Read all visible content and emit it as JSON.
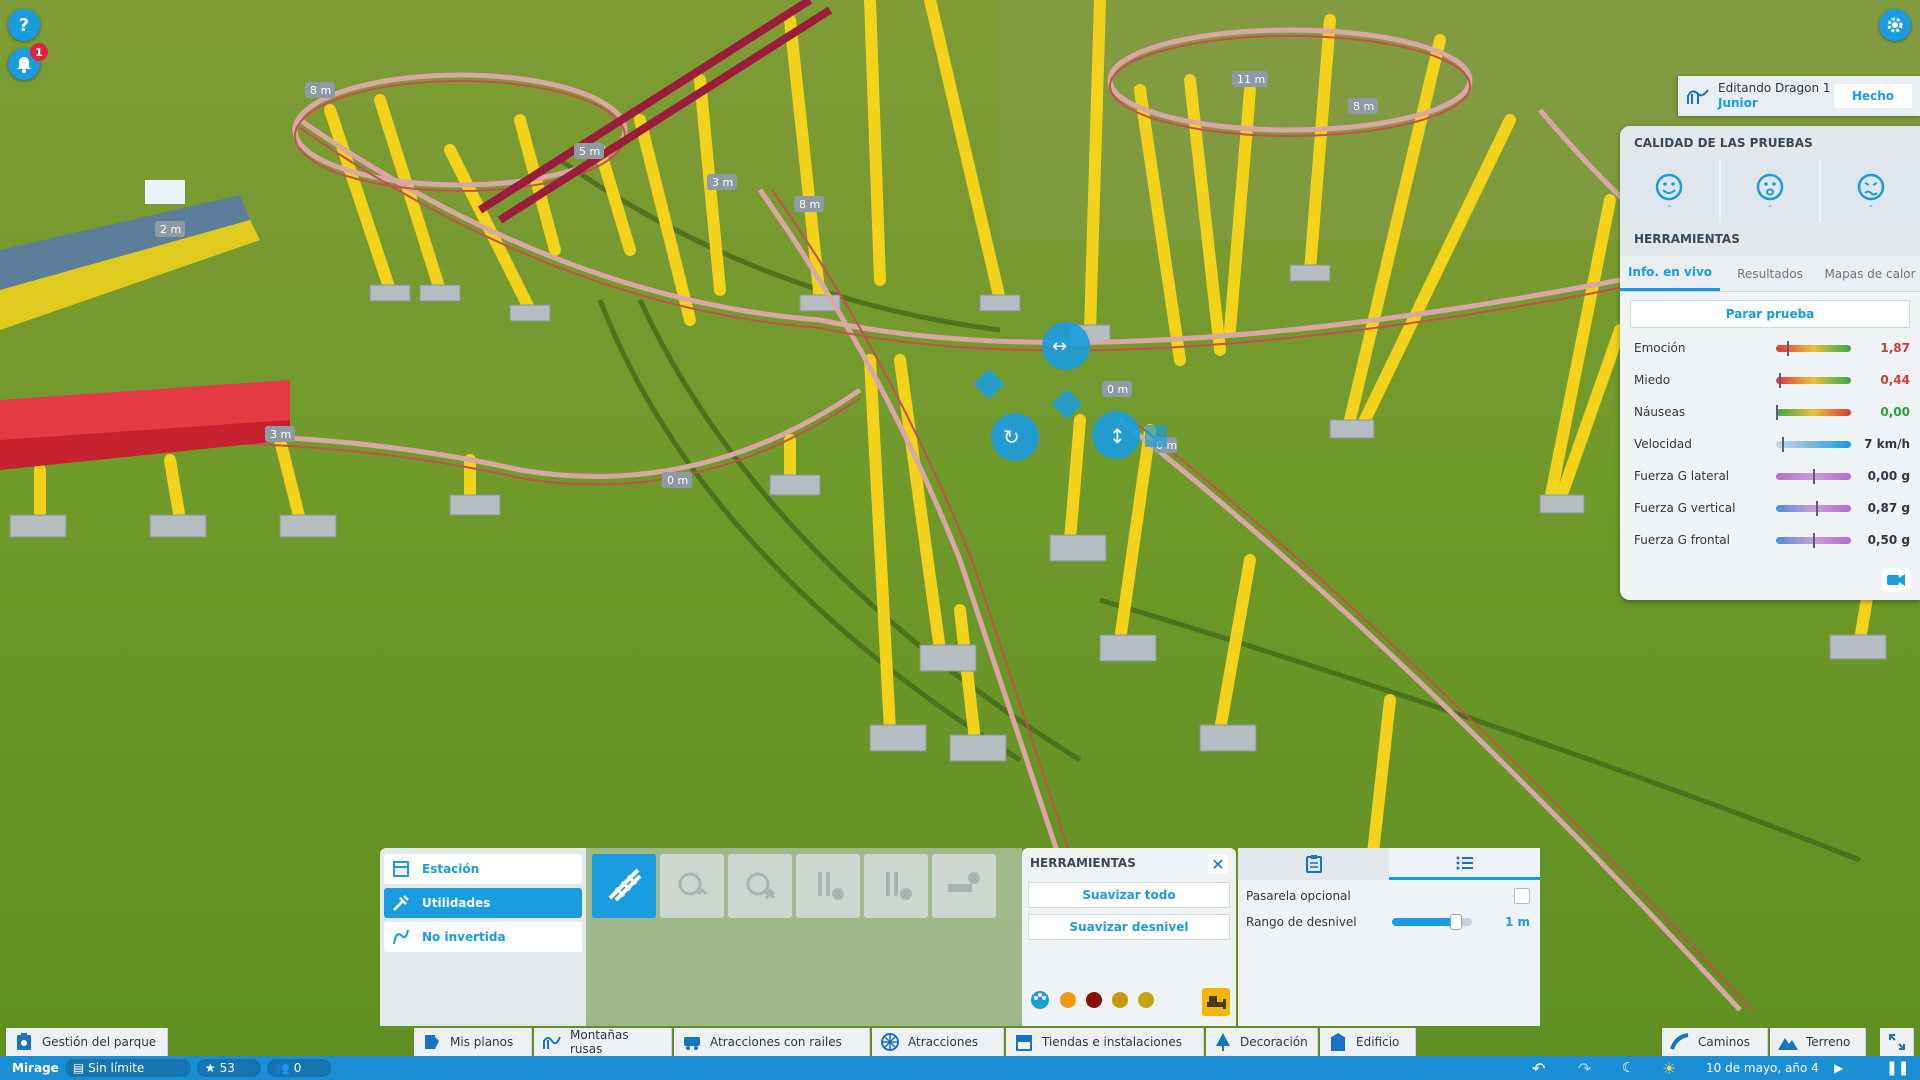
{
  "hud": {
    "help_icon": "question-icon",
    "notification_count": "1",
    "settings_icon": "gear-icon"
  },
  "editing": {
    "line1": "Editando Dragon 1",
    "line2": "Junior",
    "done_label": "Hecho"
  },
  "test_panel": {
    "quality_title": "CALIDAD DE LAS PRUEBAS",
    "faces": [
      {
        "icon": "happy-face-icon",
        "value": "-"
      },
      {
        "icon": "scared-face-icon",
        "value": "-"
      },
      {
        "icon": "sick-face-icon",
        "value": "-"
      }
    ],
    "tools_title": "HERRAMIENTAS",
    "tabs": [
      "Info. en vivo",
      "Resultados",
      "Mapas de calor"
    ],
    "active_tab": "Info. en vivo",
    "stop_button": "Parar prueba",
    "metrics": [
      {
        "label": "Emoción",
        "value": "1,87",
        "value_color": "#d03a3a",
        "marker": 0.15
      },
      {
        "label": "Miedo",
        "value": "0,44",
        "value_color": "#d03a3a",
        "marker": 0.04
      },
      {
        "label": "Náuseas",
        "value": "0,00",
        "value_color": "#2e9e3a",
        "marker": 0.0
      },
      {
        "label": "Velocidad",
        "value": "7 km/h",
        "value_color": "#2b3a48",
        "marker": 0.08
      },
      {
        "label": "Fuerza G lateral",
        "value": "0,00 g",
        "value_color": "#2b3a48",
        "marker": 0.5
      },
      {
        "label": "Fuerza G vertical",
        "value": "0,87 g",
        "value_color": "#2b3a48",
        "marker": 0.55
      },
      {
        "label": "Fuerza G frontal",
        "value": "0,50 g",
        "value_color": "#2b3a48",
        "marker": 0.5
      }
    ]
  },
  "build": {
    "categories": [
      {
        "label": "Estación",
        "icon": "station-icon",
        "active": false
      },
      {
        "label": "Utilidades",
        "icon": "utilities-icon",
        "active": true
      },
      {
        "label": "No invertida",
        "icon": "non-inverted-icon",
        "active": false
      }
    ],
    "tools": [
      {
        "icon": "track-piece-icon",
        "active": true
      },
      {
        "icon": "lift-hill-icon",
        "active": false
      },
      {
        "icon": "booster-icon",
        "active": false
      },
      {
        "icon": "brake-icon",
        "active": false
      },
      {
        "icon": "block-brake-icon",
        "active": false
      },
      {
        "icon": "transfer-track-icon",
        "active": false
      }
    ]
  },
  "tools_panel": {
    "title": "HERRAMIENTAS",
    "smooth_all": "Suavizar todo",
    "smooth_slope": "Suavizar desnivel",
    "swatches": [
      "#f39a16",
      "#8b0d0d",
      "#c99a0c",
      "#c9a20e"
    ]
  },
  "options_panel": {
    "tab_icons": [
      "clipboard-icon",
      "list-icon"
    ],
    "optional_walkway": "Pasarela opcional",
    "slope_range_label": "Rango de desnivel",
    "slope_range_value": "1 m",
    "slope_range_fraction": 0.8
  },
  "nav": {
    "park_management": "Gestión del parque",
    "items": [
      "Mis planos",
      "Montañas rusas",
      "Atracciones con railes",
      "Atracciones",
      "Tiendas e instalaciones",
      "Decoración",
      "Edificio"
    ],
    "paths": "Caminos",
    "terrain": "Terreno"
  },
  "status": {
    "park_name": "Mirage",
    "money": "Sin límite",
    "rating": "53",
    "guests": "0",
    "date": "10 de mayo, año 4"
  },
  "track_labels": [
    "8 m",
    "5 m",
    "3 m",
    "8 m",
    "2 m",
    "11 m",
    "8 m",
    "3 m",
    "0 m",
    "0 m",
    "0 m"
  ]
}
